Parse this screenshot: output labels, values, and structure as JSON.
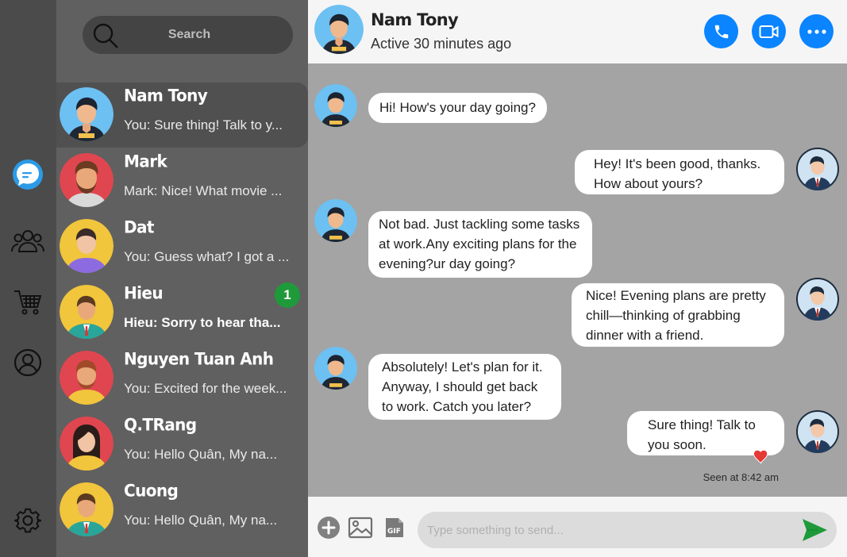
{
  "search": {
    "label": "Search"
  },
  "rail": {
    "icons": [
      "chat-bubble-icon",
      "group-icon",
      "cart-icon",
      "user-circle-icon",
      "gear-icon"
    ]
  },
  "contacts": [
    {
      "name": "Nam Tony",
      "preview": "You: Sure thing! Talk to y...",
      "active": true
    },
    {
      "name": "Mark",
      "preview": "Mark: Nice! What movie ..."
    },
    {
      "name": "Dat",
      "preview": "You: Guess what? I got a ..."
    },
    {
      "name": "Hieu",
      "preview": "Hieu: Sorry to hear tha...",
      "unread": "1"
    },
    {
      "name": "Nguyen Tuan Anh",
      "preview": "You: Excited for the week..."
    },
    {
      "name": "Q.TRang",
      "preview": "You: Hello Quân, My na..."
    },
    {
      "name": "Cuong",
      "preview": "You: Hello Quân, My na..."
    }
  ],
  "header": {
    "name": "Nam Tony",
    "status": "Active 30 minutes ago"
  },
  "messages": [
    {
      "from": "them",
      "lines": [
        "Hi! How's your day going?"
      ]
    },
    {
      "from": "me",
      "lines": [
        "Hey! It's been good, thanks.",
        "How about yours?"
      ]
    },
    {
      "from": "them",
      "lines": [
        "Not bad. Just tackling some tasks",
        "at work.Any exciting plans for the",
        "evening?ur day going?"
      ]
    },
    {
      "from": "me",
      "lines": [
        "Nice! Evening plans are pretty",
        "chill—thinking of grabbing",
        "dinner with a friend."
      ]
    },
    {
      "from": "them",
      "lines": [
        "Absolutely! Let's plan for it.",
        "Anyway, I should get back",
        "to work. Catch you later?"
      ]
    },
    {
      "from": "me",
      "lines": [
        "Sure thing! Talk to",
        "you soon."
      ]
    }
  ],
  "seen": "Seen at 8:42 am",
  "composer": {
    "placeholder": "Type something to send..."
  },
  "colors": {
    "accent": "#0a84ff",
    "send": "#1f9a3a",
    "badge": "#1f9a3a",
    "heart": "#e53935"
  }
}
